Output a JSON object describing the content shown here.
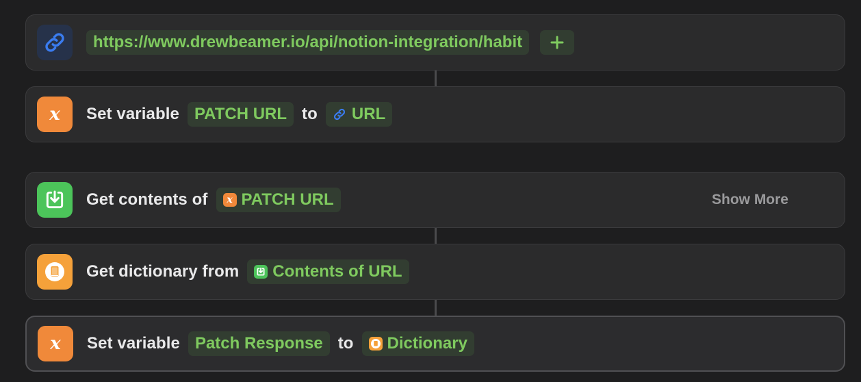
{
  "actions": [
    {
      "id": "url",
      "icon": "link-icon",
      "url_value": "https://www.drewbeamer.io/api/notion-integration/habit",
      "add_button": "+"
    },
    {
      "id": "set-variable-1",
      "icon": "variable-icon",
      "icon_glyph": "x",
      "label": "Set variable",
      "variable_name": "PATCH URL",
      "connector_word": "to",
      "value_icon": "link-icon",
      "value_label": "URL"
    },
    {
      "id": "get-contents",
      "icon": "download-icon",
      "label": "Get contents of",
      "input_icon_glyph": "x",
      "input_label": "PATCH URL",
      "show_more": "Show More"
    },
    {
      "id": "get-dictionary",
      "icon": "dictionary-icon",
      "label": "Get dictionary from",
      "input_icon": "download-icon",
      "input_label": "Contents of URL"
    },
    {
      "id": "set-variable-2",
      "icon": "variable-icon",
      "icon_glyph": "x",
      "label": "Set variable",
      "variable_name": "Patch Response",
      "connector_word": "to",
      "value_icon": "dictionary-icon",
      "value_label": "Dictionary"
    }
  ],
  "colors": {
    "background": "#1e1e1f",
    "card": "#2b2b2c",
    "token_text": "#7fca5f",
    "token_bg": "#323d31",
    "link_blue": "#3a7cf0",
    "variable_orange": "#f0893a",
    "download_green": "#4cc45a",
    "dictionary_orange": "#f5a13a"
  }
}
